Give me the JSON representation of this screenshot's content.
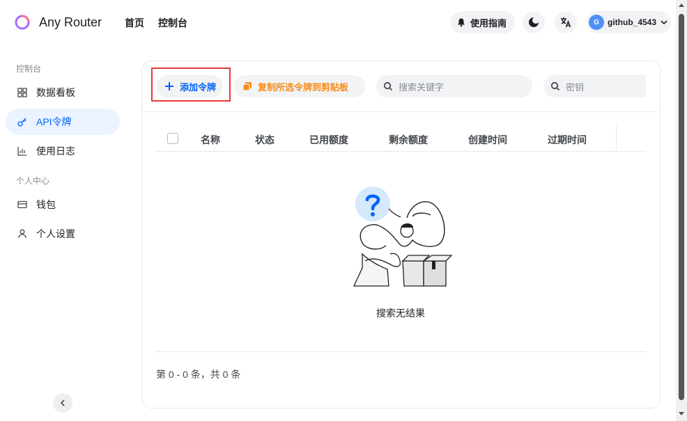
{
  "app": {
    "title": "Any Router"
  },
  "nav": {
    "home": "首页",
    "console": "控制台"
  },
  "header": {
    "guide_label": "使用指南",
    "username": "github_4543",
    "avatar_letter": "G"
  },
  "sidebar": {
    "group_console": "控制台",
    "group_personal": "个人中心",
    "items": [
      {
        "label": "数据看板",
        "icon": "dashboard-icon"
      },
      {
        "label": "API令牌",
        "icon": "key-icon",
        "active": true
      },
      {
        "label": "使用日志",
        "icon": "chart-icon"
      },
      {
        "label": "钱包",
        "icon": "wallet-icon"
      },
      {
        "label": "个人设置",
        "icon": "user-icon"
      }
    ]
  },
  "toolbar": {
    "add_label": "添加令牌",
    "copy_label": "复制所选令牌到剪贴板",
    "search_keyword_placeholder": "搜索关键字",
    "search_key_placeholder": "密钥"
  },
  "table": {
    "columns": [
      "名称",
      "状态",
      "已用额度",
      "剩余额度",
      "创建时间",
      "过期时间"
    ],
    "rows": [],
    "empty_text": "搜索无结果"
  },
  "pagination": {
    "info": "第 0 - 0 条，共 0 条"
  },
  "colors": {
    "accent": "#0064fa",
    "copy": "#fa8c16",
    "highlight": "#e53935"
  }
}
